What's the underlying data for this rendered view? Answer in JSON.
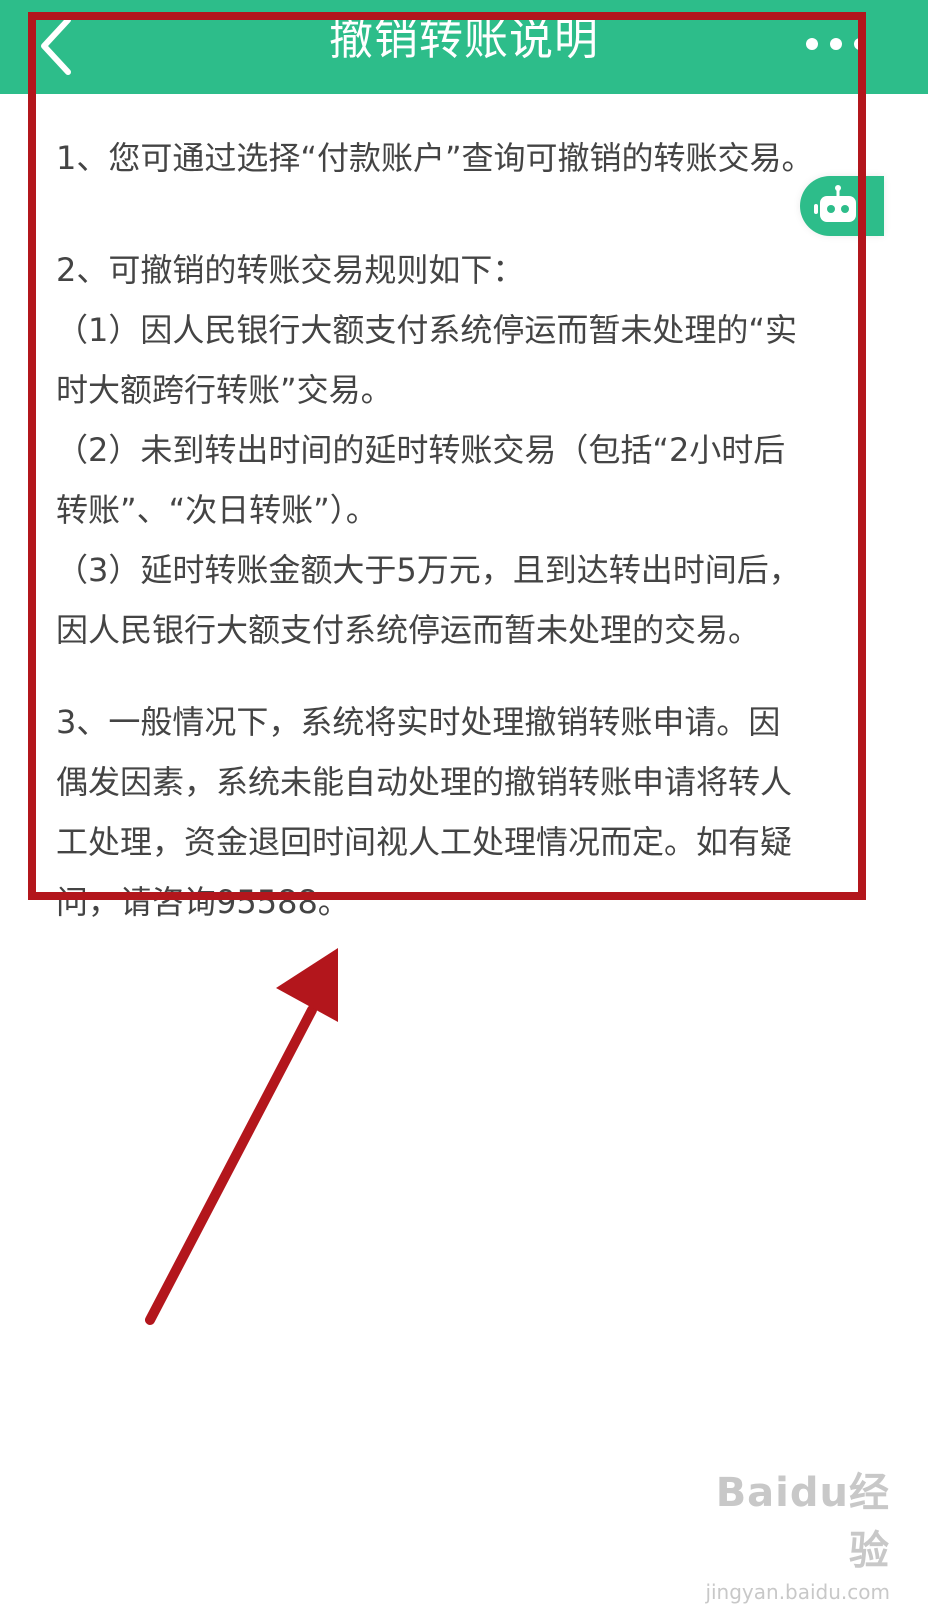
{
  "header": {
    "title": "撤销转账说明",
    "back_icon": "back-chevron-icon",
    "more_icon": "more-dots-icon",
    "background": "#2dbd8a"
  },
  "content": {
    "lines": [
      "1、您可通过选择“付款账户”查询可撤销的转账交易。",
      "2、可撤销的转账交易规则如下：",
      "（1）因人民银行大额支付系统停运而暂未处理的“实",
      "时大额跨行转账”交易。",
      "（2）未到转出时间的延时转账交易（包括“2小时后",
      "转账”、“次日转账”）。",
      "（3）延时转账金额大于5万元，且到达转出时间后，",
      "因人民银行大额支付系统停运而暂未处理的交易。",
      "3、一般情况下，系统将实时处理撤销转账申请。因",
      "偶发因素，系统未能自动处理的撤销转账申请将转人",
      "工处理，资金退回时间视人工处理情况而定。如有疑",
      "问，请咨询95588。"
    ]
  },
  "floating": {
    "robot_icon": "robot-assistant-icon"
  },
  "annotations": {
    "box_color": "#b3161c",
    "arrow_color": "#b3161c"
  },
  "watermark": {
    "brand": "Baidu经验",
    "url": "jingyan.baidu.com"
  }
}
